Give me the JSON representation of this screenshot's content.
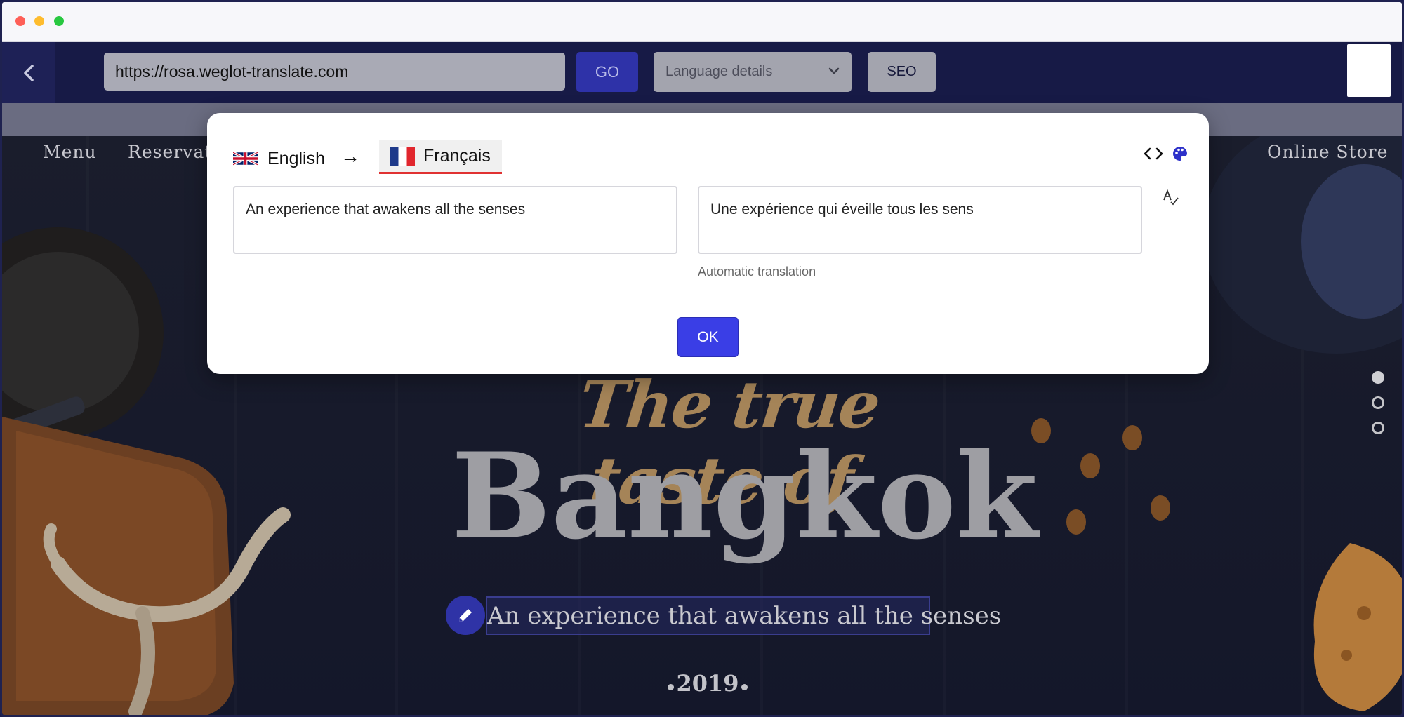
{
  "window": {
    "controls": [
      "close",
      "minimize",
      "maximize"
    ]
  },
  "toolbar": {
    "url": "https://rosa.weglot-translate.com",
    "go_label": "GO",
    "language_placeholder": "Language details",
    "seo_label": "SEO"
  },
  "site": {
    "nav": {
      "menu": "Menu",
      "reservations": "Reservati",
      "online_store": "Online Store"
    },
    "hero": {
      "script_title": "The true taste of",
      "main_title": "Bangkok",
      "subtitle": "An experience that awakens all the senses",
      "year": "2019"
    },
    "slider_dots": {
      "count": 3,
      "active": 0
    }
  },
  "modal": {
    "source_language": "English",
    "arrow": "→",
    "target_language": "Français",
    "source_text": "An experience that awakens all the senses",
    "translated_text": "Une expérience qui éveille tous les sens",
    "translation_type": "Automatic translation",
    "ok_label": "OK"
  },
  "colors": {
    "accent_blue": "#3a3ee6",
    "active_underline": "#e03131",
    "toolbar_bg": "#171a46"
  },
  "icons": [
    "back-chevron-icon",
    "chevron-down-icon",
    "code-icon",
    "palette-icon",
    "spellcheck-icon",
    "pencil-icon",
    "uk-flag-icon",
    "france-flag-icon"
  ]
}
